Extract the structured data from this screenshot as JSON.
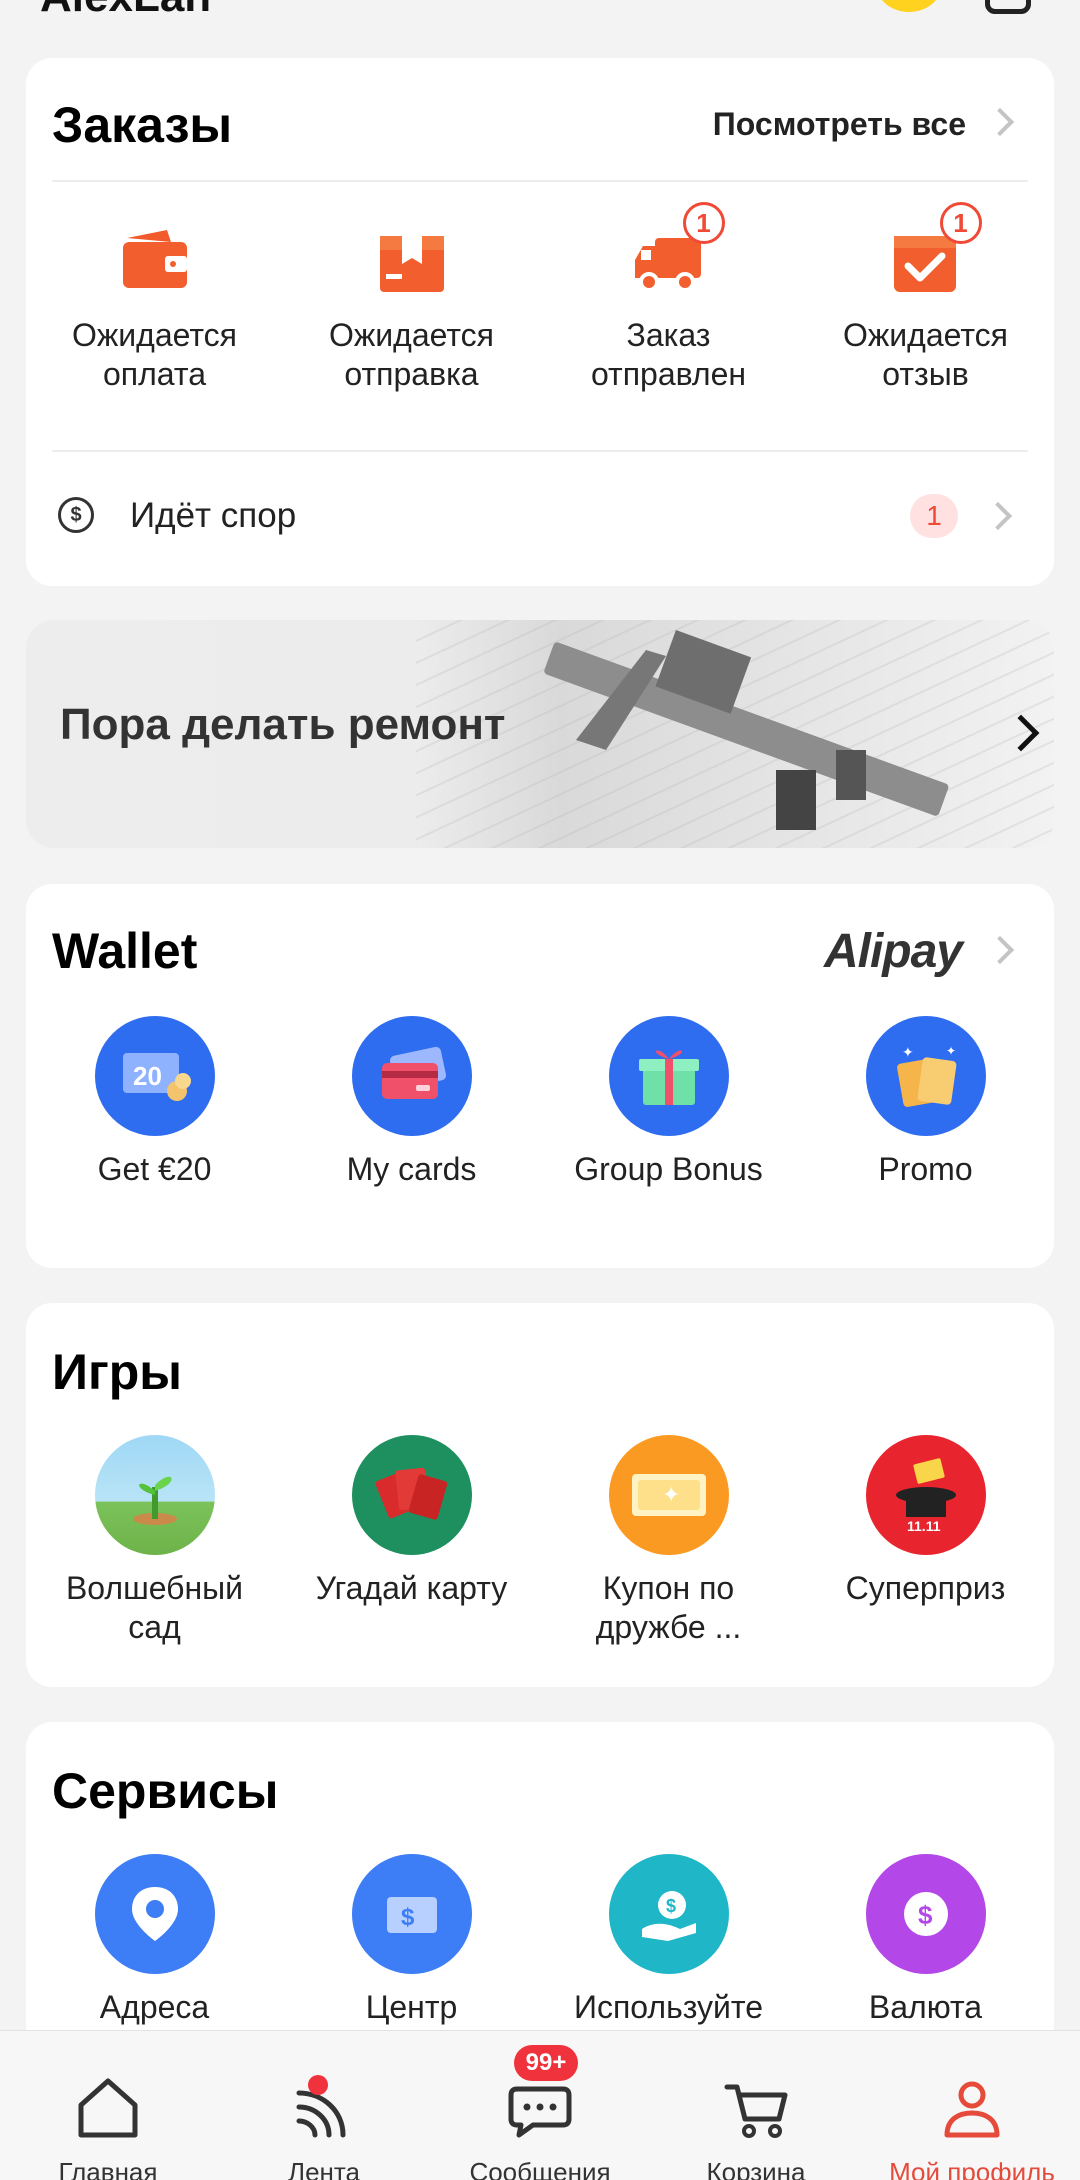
{
  "header": {
    "name": "AlexLan"
  },
  "orders": {
    "title": "Заказы",
    "view_all": "Посмотреть все",
    "items": [
      {
        "line1": "Ожидается",
        "line2": "оплата",
        "icon": "wallet-icon",
        "badge": ""
      },
      {
        "line1": "Ожидается",
        "line2": "отправка",
        "icon": "package-icon",
        "badge": ""
      },
      {
        "line1": "Заказ",
        "line2": "отправлен",
        "icon": "truck-icon",
        "badge": "1"
      },
      {
        "line1": "Ожидается",
        "line2": "отзыв",
        "icon": "review-icon",
        "badge": "1"
      }
    ],
    "dispute": {
      "label": "Идёт спор",
      "count": "1"
    }
  },
  "banner": {
    "text": "Пора делать ремонт"
  },
  "wallet": {
    "title": "Wallet",
    "provider": "Alipay",
    "items": [
      {
        "label": "Get €20",
        "icon": "voucher-icon"
      },
      {
        "label": "My cards",
        "icon": "cards-icon"
      },
      {
        "label": "Group Bonus",
        "icon": "gift-icon"
      },
      {
        "label": "Promo",
        "icon": "promo-icon"
      }
    ]
  },
  "games": {
    "title": "Игры",
    "items": [
      {
        "line1": "Волшебный",
        "line2": "сад",
        "icon": "sprout-icon"
      },
      {
        "line1": "Угадай карту",
        "line2": "",
        "icon": "cards-game-icon"
      },
      {
        "line1": "Купон по",
        "line2": "дружбе ...",
        "icon": "coupon-icon"
      },
      {
        "line1": "Суперприз",
        "line2": "",
        "icon": "magic-hat-icon"
      }
    ]
  },
  "services": {
    "title": "Сервисы",
    "items": [
      {
        "label": "Адреса",
        "icon": "location-icon"
      },
      {
        "label": "Центр",
        "icon": "ticket-icon"
      },
      {
        "label": "Используйте",
        "icon": "cashback-icon"
      },
      {
        "label": "Валюта",
        "icon": "currency-icon"
      }
    ]
  },
  "nav": {
    "items": [
      {
        "label": "Главная",
        "icon": "home-icon"
      },
      {
        "label": "Лента",
        "icon": "feed-icon"
      },
      {
        "label": "Сообщения",
        "icon": "messages-icon",
        "badge": "99+"
      },
      {
        "label": "Корзина",
        "icon": "cart-icon"
      },
      {
        "label": "Мой профиль",
        "icon": "profile-icon"
      }
    ]
  },
  "colors": {
    "accent": "#f04a36",
    "active_nav": "#e64a3b",
    "wallet_blue": "#2e6cf0"
  }
}
